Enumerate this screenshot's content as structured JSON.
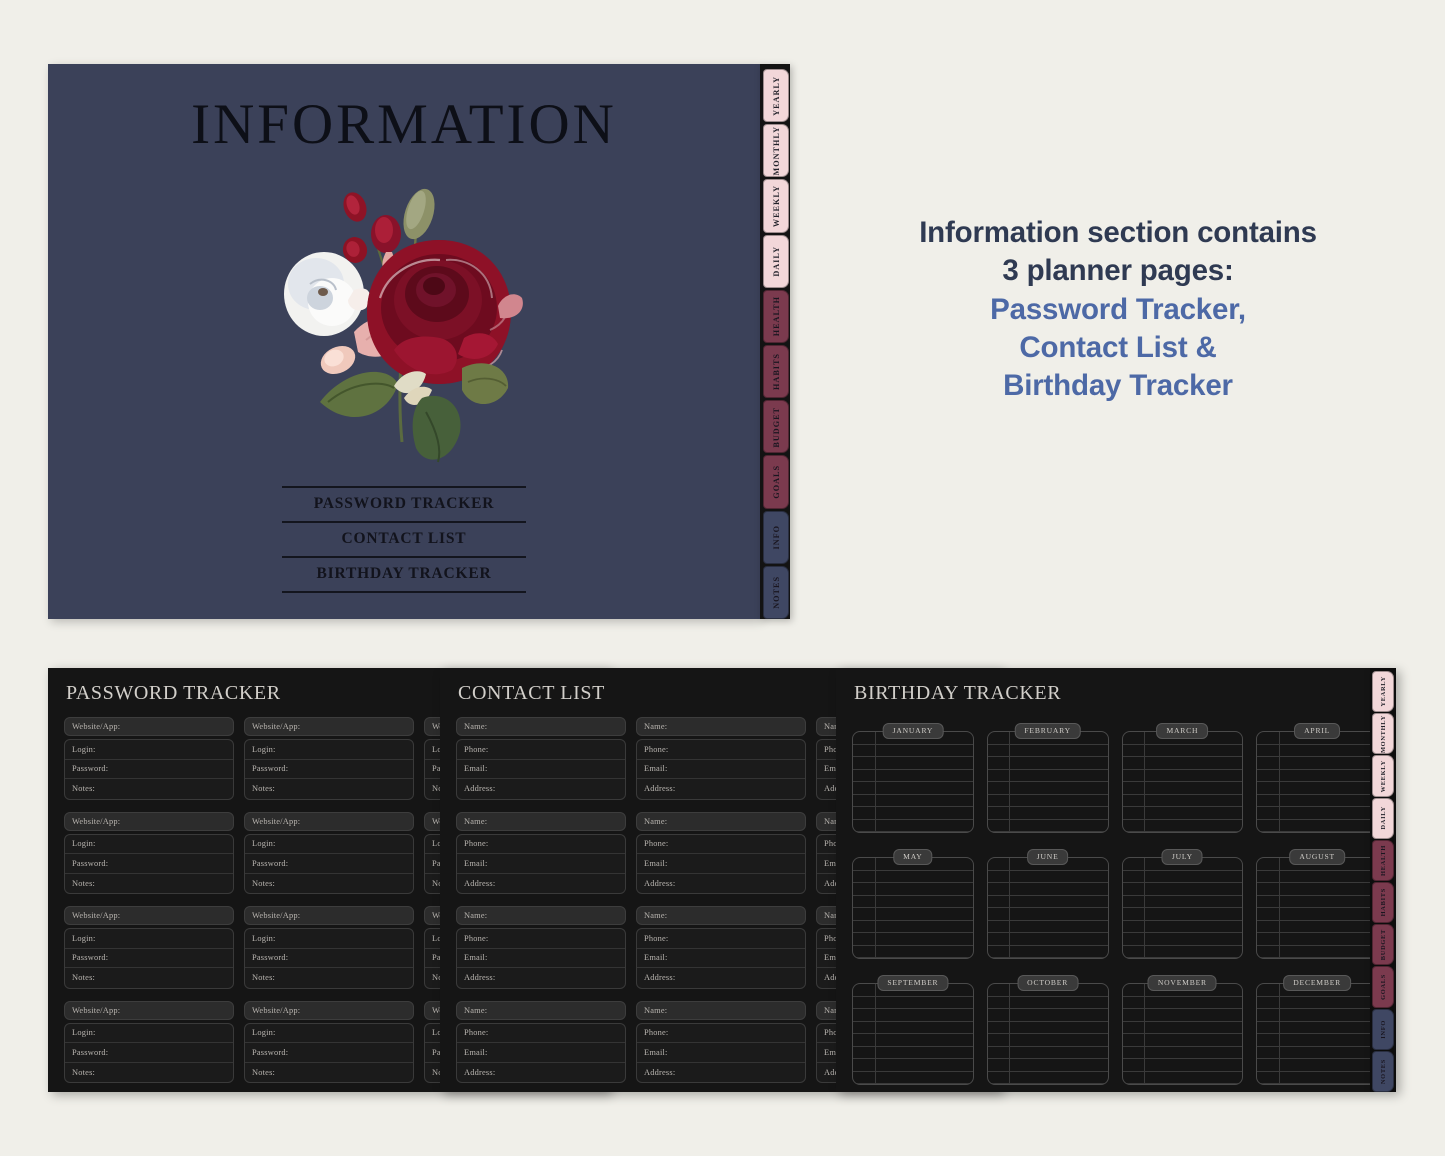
{
  "theme": {
    "page_background": "#f0efe9",
    "cover_background": "#3b4159",
    "planner_background": "#151515",
    "accent_blue": "#4d69a6",
    "heading_dark": "#2f3a52",
    "tab_pink": "#f2d7d9",
    "tab_rose": "#7b3a4e",
    "tab_navy": "#3f4763"
  },
  "cover": {
    "title": "INFORMATION",
    "flower_alt": "watercolor-floral-bouquet",
    "contents": [
      "PASSWORD TRACKER",
      "CONTACT LIST",
      "BIRTHDAY TRACKER"
    ]
  },
  "tabs": [
    {
      "label": "YEARLY",
      "style": "pink"
    },
    {
      "label": "MONTHLY",
      "style": "pink"
    },
    {
      "label": "WEEKLY",
      "style": "pink"
    },
    {
      "label": "DAILY",
      "style": "pink"
    },
    {
      "label": "HEALTH",
      "style": "rose"
    },
    {
      "label": "HABITS",
      "style": "rose"
    },
    {
      "label": "BUDGET",
      "style": "rose"
    },
    {
      "label": "GOALS",
      "style": "rose"
    },
    {
      "label": "INFO",
      "style": "navy"
    },
    {
      "label": "NOTES",
      "style": "navy"
    }
  ],
  "description": {
    "lines": [
      {
        "text": "Information section contains",
        "color": "dark"
      },
      {
        "text": "3 planner pages:",
        "color": "dark"
      },
      {
        "text": "Password Tracker,",
        "color": "blue"
      },
      {
        "text": "Contact List &",
        "color": "blue"
      },
      {
        "text": "Birthday Tracker",
        "color": "blue"
      }
    ]
  },
  "pages": {
    "password_tracker": {
      "title": "PASSWORD TRACKER",
      "header_field": "Website/App:",
      "fields": [
        "Login:",
        "Password:",
        "Notes:"
      ],
      "columns": 3,
      "rows": 4
    },
    "contact_list": {
      "title": "CONTACT LIST",
      "header_field": "Name:",
      "fields": [
        "Phone:",
        "Email:",
        "Address:"
      ],
      "columns": 3,
      "rows": 4
    },
    "birthday_tracker": {
      "title": "BIRTHDAY TRACKER",
      "rows_per_month": 8,
      "months": [
        "JANUARY",
        "FEBRUARY",
        "MARCH",
        "APRIL",
        "MAY",
        "JUNE",
        "JULY",
        "AUGUST",
        "SEPTEMBER",
        "OCTOBER",
        "NOVEMBER",
        "DECEMBER"
      ]
    }
  }
}
